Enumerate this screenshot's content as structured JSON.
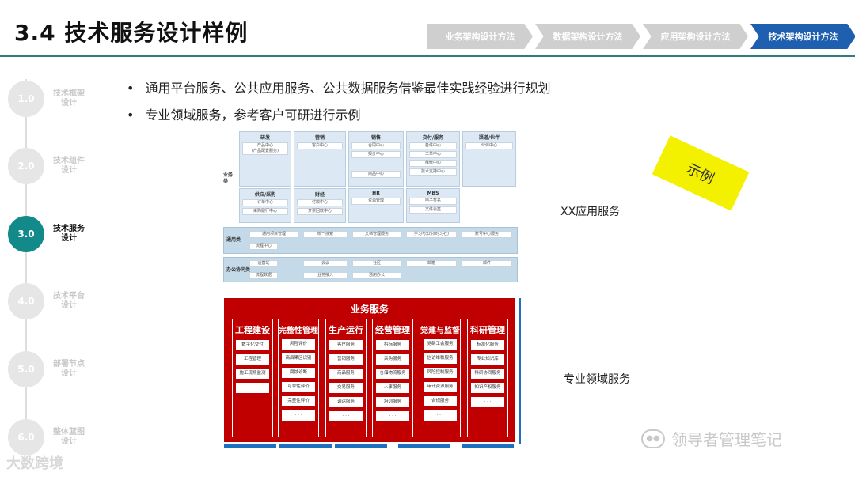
{
  "header": {
    "title": "3.4 技术服务设计样例",
    "breadcrumb": [
      "业务架构设计方法",
      "数据架构设计方法",
      "应用架构设计方法",
      "技术架构设计方法"
    ],
    "active_index": 3
  },
  "timeline": [
    {
      "num": "1.0",
      "label": "技术框架设计"
    },
    {
      "num": "2.0",
      "label": "技术组件设计"
    },
    {
      "num": "3.0",
      "label": "技术服务设计"
    },
    {
      "num": "4.0",
      "label": "技术平台设计"
    },
    {
      "num": "5.0",
      "label": "部署节点设计"
    },
    {
      "num": "6.0",
      "label": "整体蓝图设计"
    }
  ],
  "bullets": [
    "通用平台服务、公共应用服务、公共数据服务借鉴最佳实践经验进行规划",
    "专业领域服务，参考客户可研进行示例"
  ],
  "top_diagram": {
    "biz_label": "业务类",
    "groups_row1": [
      {
        "title": "研发",
        "items": [
          "产品中心",
          "(产品配置服务)"
        ]
      },
      {
        "title": "营销",
        "items": [
          "客户中心"
        ]
      },
      {
        "title": "销售",
        "items": [
          "合同中心",
          "报价中心",
          "商品中心"
        ]
      },
      {
        "title": "交付/服务",
        "items": [
          "备件中心",
          "工单中心",
          "维修中心",
          "技术支持中心"
        ]
      },
      {
        "title": "渠道/伙伴",
        "items": [
          "伙伴中心"
        ]
      }
    ],
    "groups_row2": [
      {
        "title": "供应/采购",
        "items": [
          "订单中心",
          "采购履行中心"
        ]
      },
      {
        "title": "财经",
        "items": [
          "付款中心",
          "开票回款中心"
        ]
      },
      {
        "title": "HR",
        "items": [
          "资源管理"
        ]
      },
      {
        "title": "MBS",
        "items": [
          "电子签名",
          "文件会签"
        ]
      }
    ],
    "common_label": "通用类",
    "common_items": [
      "通用项目管理",
      "统一搜索",
      "文档管理服务",
      "学习与知识(时习社)",
      "账号中心服务",
      "流程中心"
    ],
    "office_label": "办公协同类",
    "office_items": [
      "运营站",
      "会议",
      "社区",
      "邮箱",
      "邮件",
      "流程数据",
      "业务接入",
      "通用办公"
    ]
  },
  "xx_label": "XX应用服务",
  "sample_tag": "示例",
  "biz_panel": {
    "title": "业务服务",
    "columns": [
      {
        "title": "工程建设",
        "items": [
          "数字化交付",
          "工程管理",
          "施工现场监测",
          "· · ·"
        ]
      },
      {
        "title": "完整性管理",
        "items": [
          "风险评价",
          "高后果区识别",
          "腐蚀诊断",
          "可靠性评价",
          "完整性评价",
          "· · ·"
        ]
      },
      {
        "title": "生产运行",
        "items": [
          "客户服务",
          "营销服务",
          "商品服务",
          "交易服务",
          "调运服务",
          "· · ·"
        ]
      },
      {
        "title": "经营管理",
        "items": [
          "招标服务",
          "采购服务",
          "仓储物流服务",
          "人事服务",
          "培训服务",
          "· · ·"
        ]
      },
      {
        "title": "党建与监督",
        "items": [
          "党群工会服务",
          "信访维稳服务",
          "风险控制服务",
          "审计资源服务",
          "合规服务",
          "· · ·"
        ]
      },
      {
        "title": "科研管理",
        "items": [
          "标准化服务",
          "专业知识库",
          "科研协同服务",
          "知识产权服务",
          "· · ·"
        ]
      }
    ]
  },
  "spec_label": "专业领域服务",
  "watermarks": {
    "right": "领导者管理笔记",
    "left": "大数跨境"
  },
  "colors": {
    "accent_teal": "#138a8a",
    "active_crumb": "#1f5fb0",
    "panel_red": "#c00000"
  }
}
